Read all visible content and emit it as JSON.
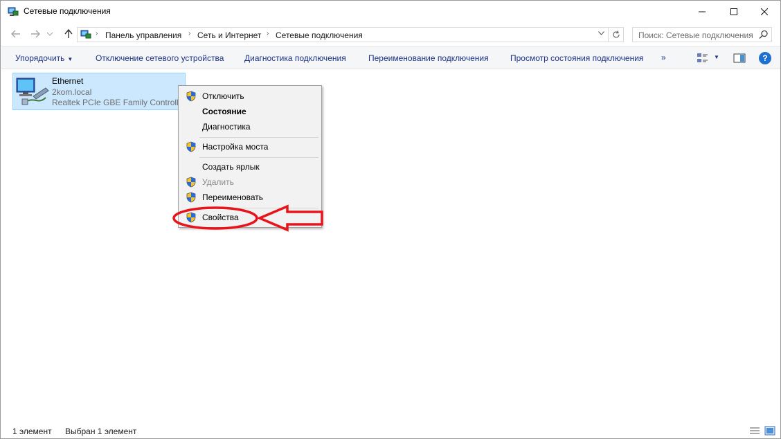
{
  "window": {
    "title": "Сетевые подключения"
  },
  "address": {
    "breadcrumbs": [
      "Панель управления",
      "Сеть и Интернет",
      "Сетевые подключения"
    ],
    "search_placeholder": "Поиск: Сетевые подключения"
  },
  "commands": {
    "organize": "Упорядочить",
    "disable": "Отключение сетевого устройства",
    "diagnose": "Диагностика подключения",
    "rename": "Переименование подключения",
    "view_status": "Просмотр состояния подключения",
    "more": "»"
  },
  "connection": {
    "name": "Ethernet",
    "domain": "2kom.local",
    "adapter": "Realtek PCIe GBE Family Controller"
  },
  "context_menu": {
    "items": [
      {
        "label": "Отключить",
        "shield": true,
        "style": "normal"
      },
      {
        "label": "Состояние",
        "shield": false,
        "style": "bold"
      },
      {
        "label": "Диагностика",
        "shield": false,
        "style": "normal"
      },
      {
        "label": "Настройка моста",
        "shield": true,
        "style": "normal"
      },
      {
        "label": "Создать ярлык",
        "shield": false,
        "style": "normal"
      },
      {
        "label": "Удалить",
        "shield": true,
        "style": "disabled"
      },
      {
        "label": "Переименовать",
        "shield": true,
        "style": "normal"
      },
      {
        "label": "Свойства",
        "shield": true,
        "style": "normal"
      }
    ]
  },
  "status": {
    "count": "1 элемент",
    "selected": "Выбран 1 элемент"
  },
  "colors": {
    "accent": "#1e3287",
    "selection": "#cce8ff",
    "annotation": "#e8141c"
  }
}
